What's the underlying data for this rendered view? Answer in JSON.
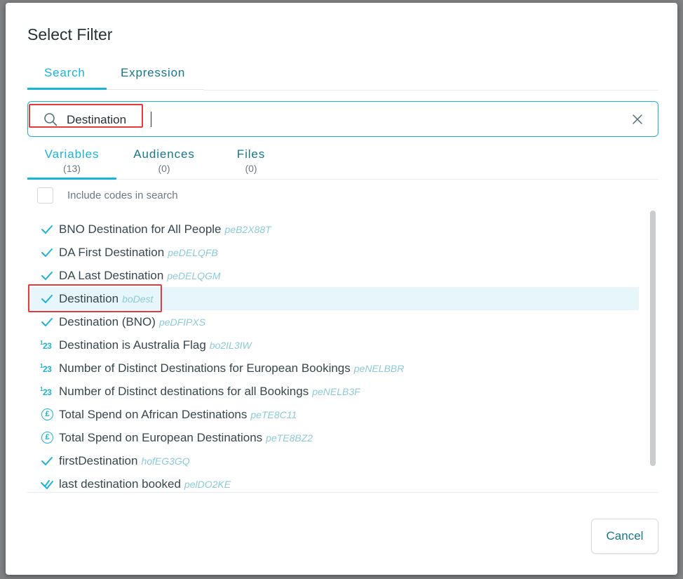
{
  "dialog": {
    "title": "Select Filter"
  },
  "tabs": [
    {
      "label": "Search",
      "active": true
    },
    {
      "label": "Expression",
      "active": false
    }
  ],
  "search": {
    "value": "Destination",
    "placeholder": ""
  },
  "subtabs": [
    {
      "label": "Variables",
      "count": "(13)",
      "active": true
    },
    {
      "label": "Audiences",
      "count": "(0)",
      "active": false
    },
    {
      "label": "Files",
      "count": "(0)",
      "active": false
    }
  ],
  "include_codes": {
    "label": "Include codes in search",
    "checked": false
  },
  "items": [
    {
      "name": "BNO Destination for All People",
      "code": "peB2X88T",
      "icon": "check-icon"
    },
    {
      "name": "DA First Destination",
      "code": "peDELQFB",
      "icon": "check-icon"
    },
    {
      "name": "DA Last Destination",
      "code": "peDELQGM",
      "icon": "check-icon"
    },
    {
      "name": "Destination",
      "code": "boDest",
      "icon": "check-icon"
    },
    {
      "name": "Destination (BNO)",
      "code": "peDFIPXS",
      "icon": "check-icon"
    },
    {
      "name": "Destination is Australia Flag",
      "code": "bo2IL3IW",
      "icon": "numeric-icon"
    },
    {
      "name": "Number of Distinct Destinations for European Bookings",
      "code": "peNELBBR",
      "icon": "numeric-icon"
    },
    {
      "name": "Number of Distinct destinations for all Bookings",
      "code": "peNELB3F",
      "icon": "numeric-icon"
    },
    {
      "name": "Total Spend on African Destinations",
      "code": "peTE8C11",
      "icon": "pound-icon"
    },
    {
      "name": "Total Spend on European Destinations",
      "code": "peTE8BZ2",
      "icon": "pound-icon"
    },
    {
      "name": "firstDestination",
      "code": "hofEG3GQ",
      "icon": "check-icon"
    },
    {
      "name": "last destination booked",
      "code": "pelDO2KE",
      "icon": "double-check-icon"
    }
  ],
  "selected_item": 3,
  "footer": {
    "cancel_label": "Cancel"
  },
  "colors": {
    "accent": "#1ab4d8",
    "teal": "#16788c",
    "highlight": "#e23b3b"
  }
}
